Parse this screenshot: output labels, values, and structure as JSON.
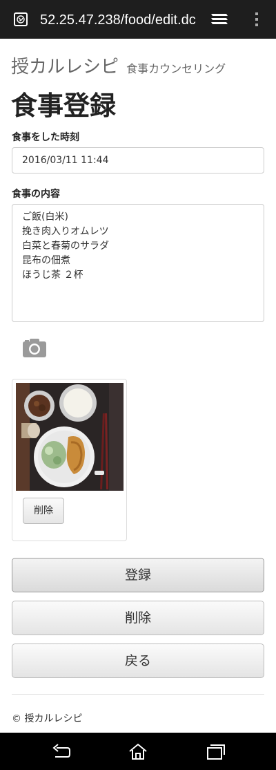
{
  "browser": {
    "url": "52.25.47.238/food/edit.dc"
  },
  "header": {
    "brand_name": "授カルレシピ",
    "brand_sub": "食事カウンセリング"
  },
  "page": {
    "title": "食事登録"
  },
  "form": {
    "time_label": "食事をした時刻",
    "time_value": "2016/03/11 11:44",
    "content_label": "食事の内容",
    "content_value": "ご飯(白米)\n挽き肉入りオムレツ\n白菜と春菊のサラダ\n昆布の佃煮\nほうじ茶 ２杯"
  },
  "photo": {
    "delete_label": "削除"
  },
  "actions": {
    "register_label": "登録",
    "delete_label": "削除",
    "back_label": "戻る"
  },
  "footer": {
    "copyright": "© 授カルレシピ"
  },
  "icons": {
    "site": "globe-icon",
    "tabs": "tabs-icon",
    "menu": "overflow-menu-icon",
    "camera": "camera-icon",
    "back": "back-icon",
    "home": "home-icon",
    "recents": "recents-icon"
  }
}
